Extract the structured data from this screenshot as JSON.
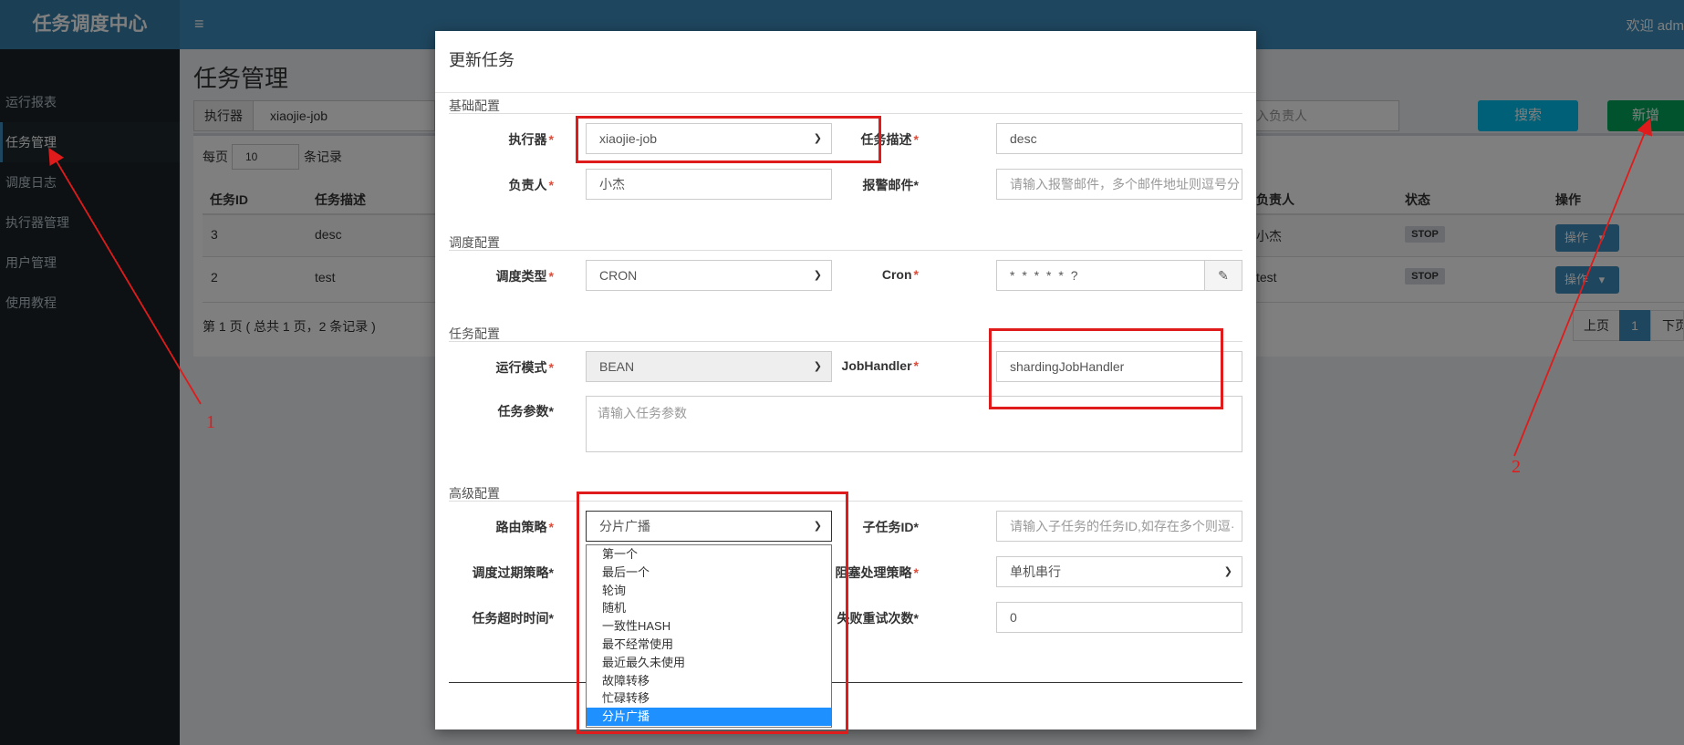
{
  "app": {
    "logo": "任务调度中心",
    "hamburger": "≡",
    "welcome": "欢迎 adm"
  },
  "sidebar": {
    "items": [
      {
        "label": "运行报表"
      },
      {
        "label": "任务管理"
      },
      {
        "label": "调度日志"
      },
      {
        "label": "执行器管理"
      },
      {
        "label": "用户管理"
      },
      {
        "label": "使用教程"
      }
    ],
    "active_index": 1
  },
  "page": {
    "title": "任务管理",
    "executor_label": "执行器",
    "executor_value": "xiaojie-job",
    "owner_placeholder": "入负责人",
    "search_button": "搜索",
    "add_button": "新增",
    "per_page_label": "每页",
    "per_page_value": "10",
    "per_page_suffix": "条记录",
    "table": {
      "headers": [
        "任务ID",
        "任务描述",
        "负责人",
        "状态",
        "操作"
      ],
      "rows": [
        {
          "id": "3",
          "desc": "desc",
          "owner": "小杰",
          "status": "STOP",
          "action": "操作"
        },
        {
          "id": "2",
          "desc": "test",
          "owner": "test",
          "status": "STOP",
          "action": "操作"
        }
      ]
    },
    "pagination_info": "第 1 页 ( 总共 1 页，2 条记录 )",
    "pager": {
      "prev": "上页",
      "current": "1",
      "next": "下页"
    }
  },
  "modal": {
    "title": "更新任务",
    "sections": {
      "basic": "基础配置",
      "schedule": "调度配置",
      "task": "任务配置",
      "advanced": "高级配置"
    },
    "fields": {
      "executor": {
        "label": "执行器",
        "value": "xiaojie-job"
      },
      "job_desc": {
        "label": "任务描述",
        "value": "desc"
      },
      "owner": {
        "label": "负责人",
        "value": "小杰"
      },
      "alarm_email": {
        "label": "报警邮件",
        "placeholder": "请输入报警邮件，多个邮件地址则逗号分"
      },
      "schedule_type": {
        "label": "调度类型",
        "value": "CRON"
      },
      "cron": {
        "label": "Cron",
        "value": "* * * * * ?"
      },
      "run_mode": {
        "label": "运行模式",
        "value": "BEAN"
      },
      "job_handler": {
        "label": "JobHandler",
        "value": "shardingJobHandler"
      },
      "job_params": {
        "label": "任务参数",
        "placeholder": "请输入任务参数"
      },
      "route_strategy": {
        "label": "路由策略",
        "value": "分片广播"
      },
      "child_job_id": {
        "label": "子任务ID",
        "placeholder": "请输入子任务的任务ID,如存在多个则逗·"
      },
      "misfire_strategy": {
        "label": "调度过期策略"
      },
      "block_strategy": {
        "label": "阻塞处理策略",
        "value": "单机串行"
      },
      "timeout": {
        "label": "任务超时时间"
      },
      "fail_retry": {
        "label": "失败重试次数",
        "value": "0"
      }
    },
    "route_options": [
      "第一个",
      "最后一个",
      "轮询",
      "随机",
      "一致性HASH",
      "最不经常使用",
      "最近最久未使用",
      "故障转移",
      "忙碌转移",
      "分片广播"
    ],
    "route_selected": "分片广播"
  },
  "annotations": {
    "label_1": "1",
    "label_2": "2"
  },
  "colors": {
    "annotation_red": "#e01b1b",
    "primary": "#3c8dbc",
    "success": "#00a65a",
    "info": "#00c0ef",
    "sidebar_bg": "#1a2226"
  }
}
